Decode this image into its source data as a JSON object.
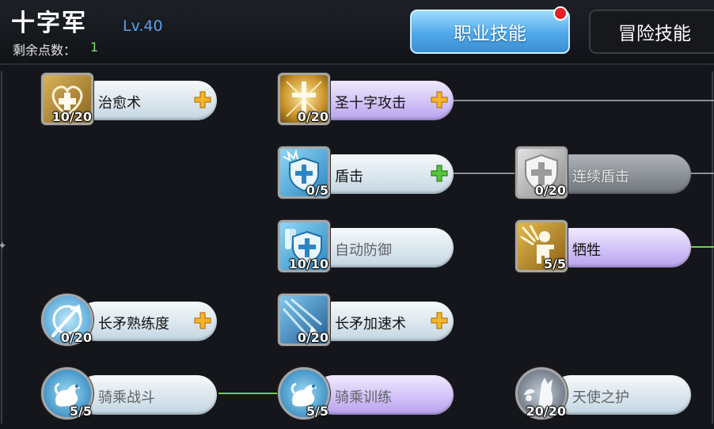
{
  "header": {
    "class_name": "十字军",
    "level": "Lv.40",
    "points_label": "剩余点数：",
    "points_value": "1"
  },
  "tabs": [
    {
      "label": "职业技能",
      "active": true,
      "notification": true
    },
    {
      "label": "冒险技能",
      "active": false
    }
  ],
  "skills": [
    {
      "name": "治愈术",
      "count": "10/20",
      "icon": "heart-cross-icon",
      "can_upgrade": true
    },
    {
      "name": "圣十字攻击",
      "count": "0/20",
      "icon": "holy-cross-sword-icon",
      "can_upgrade": true
    },
    {
      "name": "盾击",
      "count": "0/5",
      "icon": "shield-bash-icon",
      "can_upgrade": true,
      "upgrade_color": "green"
    },
    {
      "name": "连续盾击",
      "count": "0/20",
      "icon": "shield-icon",
      "locked": true
    },
    {
      "name": "自动防御",
      "count": "10/10",
      "icon": "auto-guard-icon"
    },
    {
      "name": "牺牲",
      "count": "5/5",
      "icon": "sacrifice-icon"
    },
    {
      "name": "长矛熟练度",
      "count": "0/20",
      "icon": "spear-mastery-icon",
      "can_upgrade": true
    },
    {
      "name": "长矛加速术",
      "count": "0/20",
      "icon": "spear-haste-icon",
      "can_upgrade": true
    },
    {
      "name": "骑乘战斗",
      "count": "5/5",
      "icon": "mount-combat-icon"
    },
    {
      "name": "骑乘训练",
      "count": "5/5",
      "icon": "mount-training-icon"
    },
    {
      "name": "天使之护",
      "count": "20/20",
      "icon": "angel-guard-icon"
    }
  ],
  "colors": {
    "active_tab": "#4fa8e8",
    "upgrade_plus": "#f7b52a",
    "upgrade_plus_green": "#58c43a",
    "level_text": "#5aa0e6",
    "points_value": "#7ee06a",
    "connector_active": "#6fd04a",
    "connector_inactive": "#8a8d92"
  }
}
